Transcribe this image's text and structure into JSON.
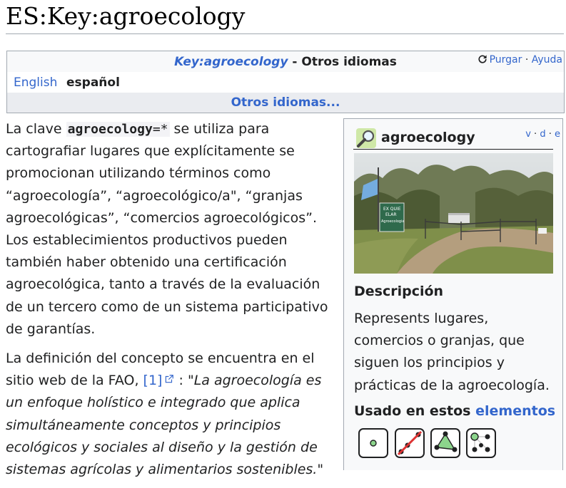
{
  "page": {
    "title": "ES:Key:agroecology"
  },
  "languages_box": {
    "key_link": "Key:agroecology",
    "heading_suffix": " - Otros idiomas",
    "purge_label": "Purgar",
    "separator": "·",
    "help_label": "Ayuda",
    "english_label": "English",
    "current_language": "español",
    "more_languages_label": "Otros idiomas..."
  },
  "content": {
    "p1_before": "La clave ",
    "p1_code": "agroecology",
    "p1_code_suffix": "=*",
    "p1_after": " se utiliza para cartografiar lugares que explícitamente se promocionan utilizando términos como “agroecología”, “agroecológico/a\", “granjas agroecológicas”, “comercios agroecológicos”. Los establecimientos productivos pueden también haber obtenido una certificación agroecológica, tanto a través de la evaluación de un tercero como de un sistema participativo de garantías.",
    "p2_before": "La definición del concepto se encuentra en el sitio web de la FAO, ",
    "p2_ref": "[1]",
    "p2_colon": " : ",
    "p2_quote": "\"La agroecología es un enfoque holístico e integrado que aplica simultáneamente conceptos y principios ecológicos y sociales al diseño y la gestión de sistemas agrícolas y alimentarios sostenibles.\""
  },
  "infobox": {
    "title": "agroecology",
    "vde": {
      "v": "v",
      "d": "d",
      "e": "e",
      "sep": "·"
    },
    "photo_sign_text": [
      "EX QUIE",
      "ELAR",
      "Agroecologia"
    ],
    "description_heading": "Descripción",
    "description": "Represents lugares, comercios o granjas, que siguen los principios y prácticas de la agroecología.",
    "used_on_prefix": "Usado en estos ",
    "used_on_link": "elementos",
    "element_icons": [
      "node-icon",
      "way-not-allowed-icon",
      "area-icon",
      "relation-icon"
    ]
  },
  "colors": {
    "link": "#3366cc",
    "border": "#a2a9b1",
    "panel": "#f8f9fa",
    "element_green": "#8cd58c"
  }
}
